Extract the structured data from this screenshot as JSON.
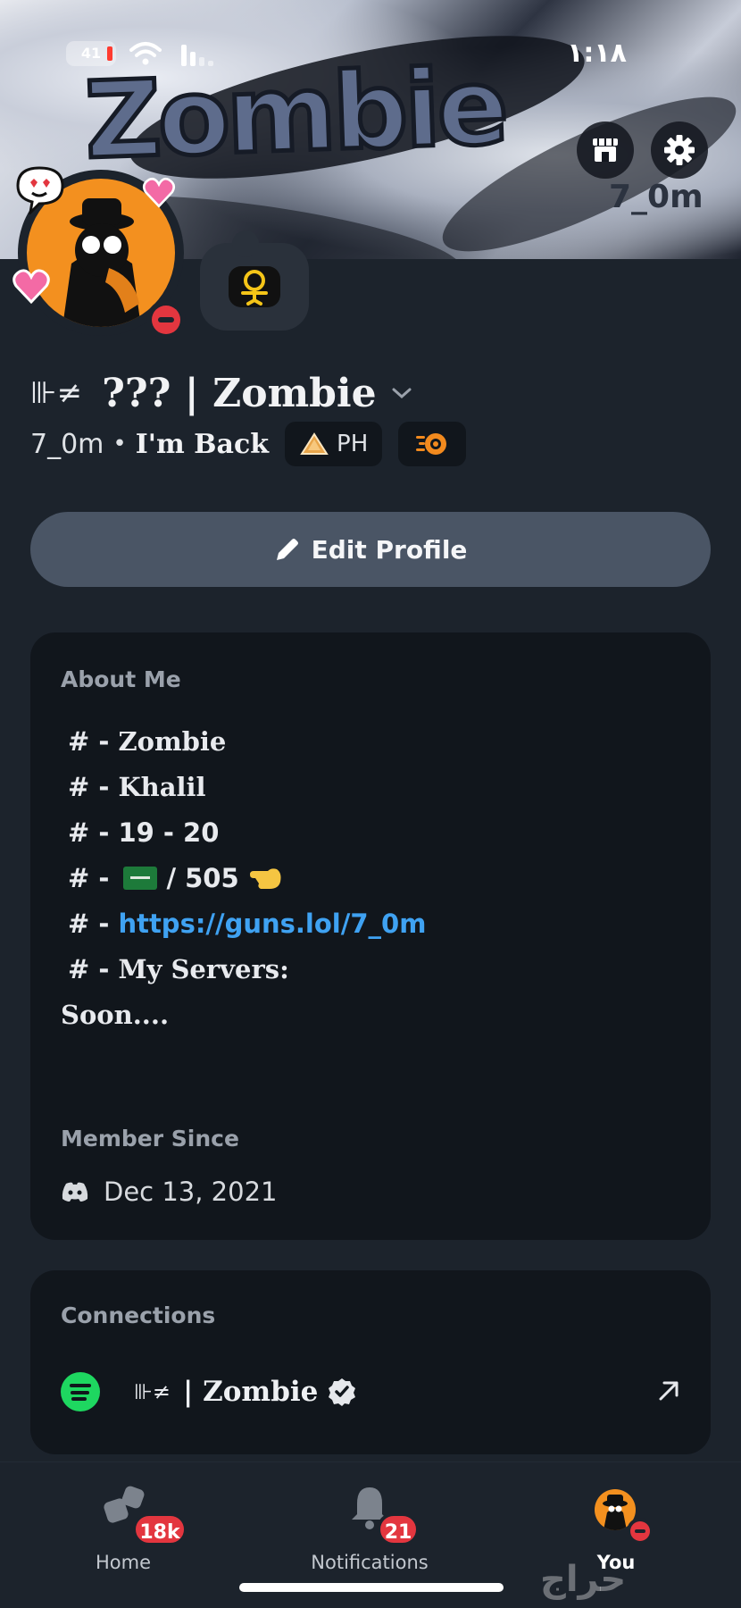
{
  "status_bar": {
    "time": "١:١٨",
    "battery": "41"
  },
  "banner": {
    "title": "Zombie",
    "handle": "7_0m",
    "shop_icon": "shop-icon",
    "settings_icon": "gear-icon"
  },
  "profile": {
    "name_glyph": "⊪≠",
    "display_name": "??? | Zombie",
    "username": "7_0m",
    "pronouns": "I'm Back",
    "tag_label": "PH",
    "status": "dnd"
  },
  "actions": {
    "edit_profile": "Edit Profile"
  },
  "about": {
    "label": "About Me",
    "prefix": "# -",
    "lines": {
      "l1": "Zombie",
      "l2": "Khalil",
      "l3": "19 - 20",
      "l4": "/ 505",
      "l5": "https://guns.lol/7_0m",
      "l6": "My Servers:",
      "l7": "Soon...."
    },
    "member_since_label": "Member Since",
    "member_since": "Dec 13, 2021"
  },
  "connections": {
    "label": "Connections",
    "items": [
      {
        "service": "spotify",
        "glyph": "⊪≠",
        "name": "| Zombie",
        "verified": true
      }
    ]
  },
  "nav": {
    "home": {
      "label": "Home",
      "badge": "18k"
    },
    "notifications": {
      "label": "Notifications",
      "badge": "21"
    },
    "you": {
      "label": "You"
    }
  },
  "watermark": "حراج",
  "colors": {
    "background": "#1c232c",
    "card": "#11161c",
    "accent_link": "#3fa2f2",
    "dnd_red": "#e3363f",
    "spotify_green": "#1ed760",
    "edit_button": "#4a5565"
  }
}
